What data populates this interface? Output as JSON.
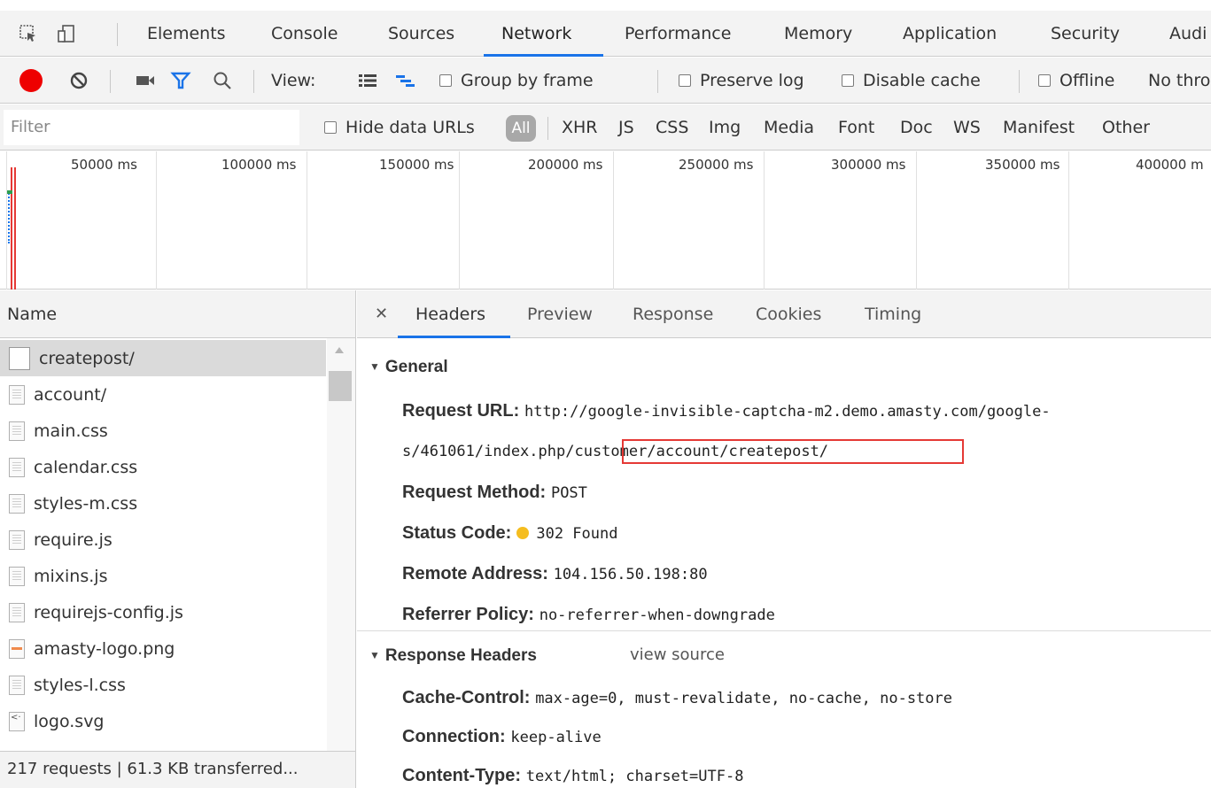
{
  "devtools": {
    "tabs": [
      "Elements",
      "Console",
      "Sources",
      "Network",
      "Performance",
      "Memory",
      "Application",
      "Security",
      "Audi"
    ],
    "active_tab": "Network",
    "icons": [
      "inspect-element-icon",
      "device-toolbar-icon"
    ]
  },
  "toolbar": {
    "record_color": "#ee0000",
    "view_label": "View:",
    "group_by_frame": "Group by frame",
    "preserve_log": "Preserve log",
    "disable_cache": "Disable cache",
    "offline": "Offline",
    "throttle": "No thro"
  },
  "filterbar": {
    "placeholder": "Filter",
    "hide_data_urls": "Hide data URLs",
    "types": [
      "All",
      "XHR",
      "JS",
      "CSS",
      "Img",
      "Media",
      "Font",
      "Doc",
      "WS",
      "Manifest",
      "Other"
    ]
  },
  "overview": {
    "ticks": [
      "50000 ms",
      "100000 ms",
      "150000 ms",
      "200000 ms",
      "250000 ms",
      "300000 ms",
      "350000 ms",
      "400000 m"
    ]
  },
  "requests": {
    "column_header": "Name",
    "items": [
      {
        "name": "createpost/",
        "type": "doc"
      },
      {
        "name": "account/",
        "type": "text"
      },
      {
        "name": "main.css",
        "type": "text"
      },
      {
        "name": "calendar.css",
        "type": "text"
      },
      {
        "name": "styles-m.css",
        "type": "text"
      },
      {
        "name": "require.js",
        "type": "text"
      },
      {
        "name": "mixins.js",
        "type": "text"
      },
      {
        "name": "requirejs-config.js",
        "type": "text"
      },
      {
        "name": "amasty-logo.png",
        "type": "img"
      },
      {
        "name": "styles-l.css",
        "type": "text"
      },
      {
        "name": "logo.svg",
        "type": "svg"
      }
    ],
    "summary": "217 requests | 61.3 KB transferred..."
  },
  "details": {
    "tabs": [
      "Headers",
      "Preview",
      "Response",
      "Cookies",
      "Timing"
    ],
    "active_tab": "Headers",
    "general": {
      "title": "General",
      "request_url_key": "Request URL:",
      "request_url_line1": "http://google-invisible-captcha-m2.demo.amasty.com/google-",
      "request_url_line2_prefix": "s/461061/index.php/",
      "request_url_line2_highlight": "customer/account/createpost/",
      "request_method_key": "Request Method:",
      "request_method": "POST",
      "status_code_key": "Status Code:",
      "status_code": "302 Found",
      "status_color": "#f5bd1f",
      "remote_address_key": "Remote Address:",
      "remote_address": "104.156.50.198:80",
      "referrer_policy_key": "Referrer Policy:",
      "referrer_policy": "no-referrer-when-downgrade"
    },
    "response_headers": {
      "title": "Response Headers",
      "view_source": "view source",
      "cache_control_key": "Cache-Control:",
      "cache_control": "max-age=0, must-revalidate, no-cache, no-store",
      "connection_key": "Connection:",
      "connection": "keep-alive",
      "content_type_key": "Content-Type:",
      "content_type": "text/html; charset=UTF-8"
    }
  }
}
